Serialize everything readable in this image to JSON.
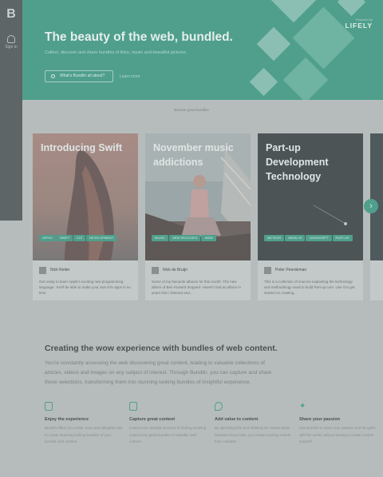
{
  "sidebar": {
    "logo": "B",
    "signin_label": "Sign in"
  },
  "hero": {
    "title": "The beauty of the web, bundled.",
    "subtitle": "Collect, discover and share bundles of links, music and beautiful pictures.",
    "cta_label": "What's Bundlin all about?",
    "secondary_link": "Learn more",
    "brand_powered": "Powered by",
    "brand_name": "LIFELY",
    "color": "#4f9f8c"
  },
  "tagline": "Browse great bundles",
  "cards": [
    {
      "title": "Introducing Swift",
      "tags": [
        "APPLE",
        "SWIFT",
        "iOS",
        "DEVELOPMENT"
      ],
      "author": "Nick Reiter",
      "description": "Get ready to learn Apple's exciting new programming language. You'll be able to make your own iOS apps in no time."
    },
    {
      "title": "November music addictions",
      "tags": [
        "MUSIC",
        "NEW RELEASES",
        "INDIE"
      ],
      "author": "Nick de Bruijn",
      "description": "Some of my favourite albums for this month. The new album of Ben Howard dropped. Haven't had an album in years that I listened and..."
    },
    {
      "title": "Part-up Development Technology",
      "tags": [
        "METEOR",
        "MEAN.JS",
        "JAVASCRIPT",
        "PART-UP"
      ],
      "author": "Peter Peerdeman",
      "description": "This is a collection of sources explaining the technology and methodology used to build Part-up.com. Use it to get started on creating..."
    }
  ],
  "next_arrow": "›",
  "intro": {
    "heading": "Creating the wow experience with bundles of web content.",
    "body": "You're constantly accessing the web discovering great content, leading to valuable collections of articles, videos and images on any subject of interest. Through Bundlin, you can capture and share these selections, transforming them into stunning looking bundles of insightful experience."
  },
  "features": [
    {
      "icon": "lock-icon",
      "title": "Enjoy the experience",
      "desc": "Bundlin offers you a fast, easy and delightful way to create stunning looking bundles of your favorite web content."
    },
    {
      "icon": "document-icon",
      "title": "Capture great content",
      "desc": "Capture the valuable process of finding amazing content into great bundles of valuable web content."
    },
    {
      "icon": "pin-icon",
      "title": "Add value to content",
      "desc": "By spending time and defining the relationships between those links, you create exciting content from valuable."
    },
    {
      "icon": "twitter-icon",
      "title": "Share your passion",
      "desc": "Use Bundlin to share your passion and thoughts with the world, without having to create content yourself."
    }
  ]
}
